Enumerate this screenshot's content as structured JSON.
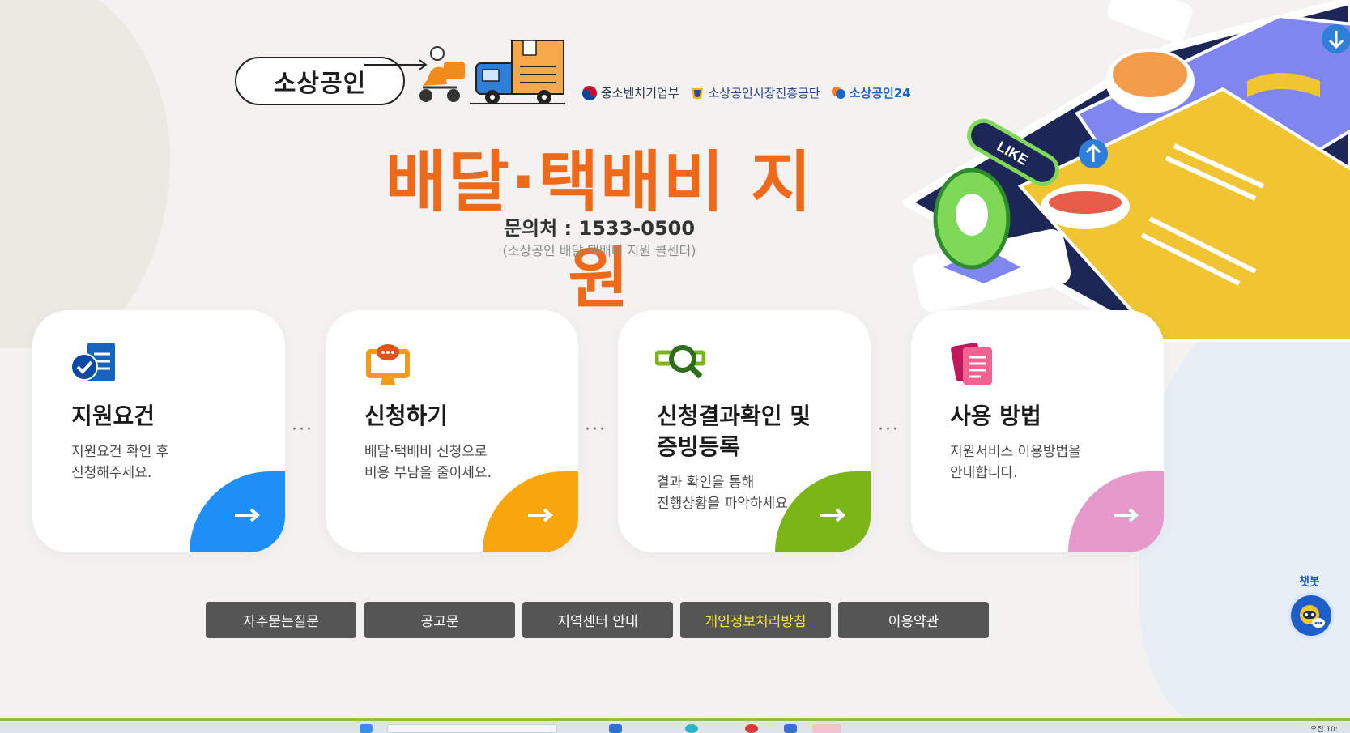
{
  "header": {
    "brand_text": "소상공인",
    "orgs": [
      {
        "label": "중소벤처기업부"
      },
      {
        "label": "소상공인시장진흥공단"
      },
      {
        "label": "소상공인24"
      }
    ],
    "title": "배달·택배비 지원",
    "contact": "문의처 : 1533-0500",
    "contact_sub": "(소상공인 배달·택배비 지원 콜센터)"
  },
  "illustration": {
    "like_label": "LIKE"
  },
  "cards": [
    {
      "title": "지원요건",
      "desc_line1": "지원요건 확인 후",
      "desc_line2": "신청해주세요.",
      "accent": "#1e90f5",
      "icon": "document-check-icon"
    },
    {
      "title": "신청하기",
      "desc_line1": "배달·택배비 신청으로",
      "desc_line2": "비용 부담을 줄이세요.",
      "accent": "#f9a60e",
      "icon": "monitor-chat-icon"
    },
    {
      "title_line1": "신청결과확인 및",
      "title_line2": "증빙등록",
      "desc_line1": "결과 확인을 통해",
      "desc_line2": "진행상황을 파악하세요.",
      "accent": "#7cb518",
      "icon": "magnifier-icon"
    },
    {
      "title": "사용 방법",
      "desc_line1": "지원서비스 이용방법을",
      "desc_line2": "안내합니다.",
      "accent": "#e59acb",
      "icon": "pages-icon"
    }
  ],
  "buttons": [
    {
      "label": "자주묻는질문"
    },
    {
      "label": "공고문"
    },
    {
      "label": "지역센터 안내"
    },
    {
      "label": "개인정보처리방침"
    },
    {
      "label": "이용약관"
    }
  ],
  "chatbot": {
    "label": "챗봇"
  },
  "taskbar": {
    "clock": "오전 10:"
  }
}
